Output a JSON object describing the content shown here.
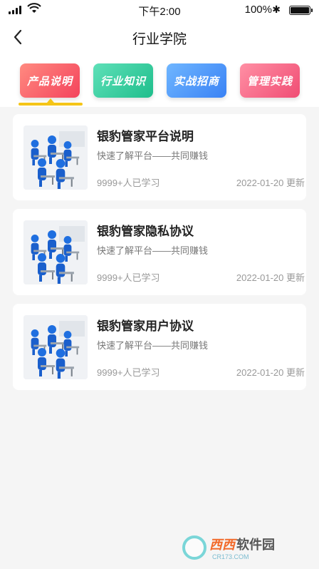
{
  "status_bar": {
    "time": "下午2:00",
    "battery_percent": "100%",
    "battery_level": 1.0
  },
  "nav": {
    "title": "行业学院"
  },
  "tabs": [
    {
      "label": "产品说明",
      "selected": true,
      "color": "#f4435c"
    },
    {
      "label": "行业知识",
      "selected": false,
      "color": "#1fbe8c"
    },
    {
      "label": "实战招商",
      "selected": false,
      "color": "#3a82f5"
    },
    {
      "label": "管理实践",
      "selected": false,
      "color": "#f04d74"
    }
  ],
  "accent_color": "#f5c518",
  "articles": [
    {
      "title": "银豹管家平台说明",
      "subtitle": "快速了解平台——共同赚钱",
      "learners": "9999+人已学习",
      "updated": "2022-01-20 更新",
      "thumb_icon": "classroom-image"
    },
    {
      "title": "银豹管家隐私协议",
      "subtitle": "快速了解平台——共同赚钱",
      "learners": "9999+人已学习",
      "updated": "2022-01-20 更新",
      "thumb_icon": "classroom-image"
    },
    {
      "title": "银豹管家用户协议",
      "subtitle": "快速了解平台——共同赚钱",
      "learners": "9999+人已学习",
      "updated": "2022-01-20 更新",
      "thumb_icon": "classroom-image"
    }
  ],
  "watermark": {
    "brand_a": "西西",
    "brand_b": "软件园",
    "site": "CR173.COM"
  }
}
